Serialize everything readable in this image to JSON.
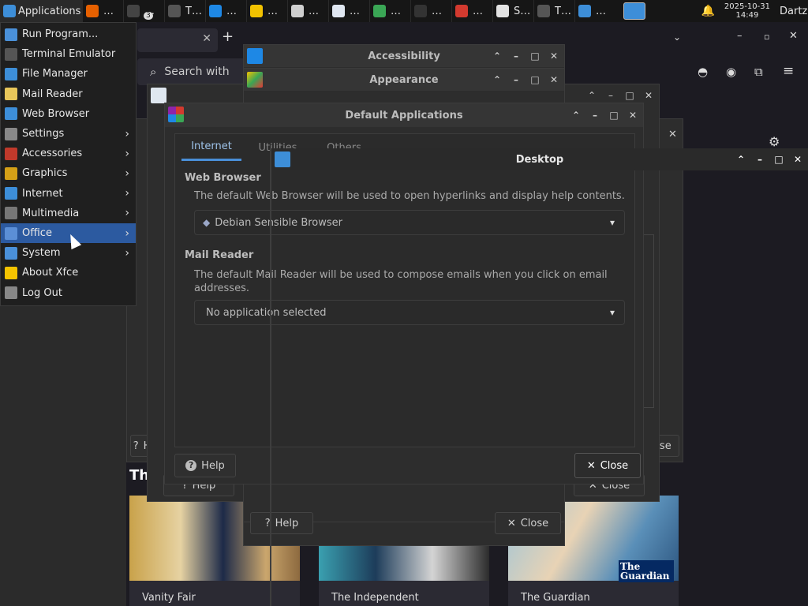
{
  "taskbar": {
    "applications_label": "Applications",
    "tasks": [
      {
        "label": "…",
        "icon": "firefox-icon",
        "color": "#e66000"
      },
      {
        "label": "…",
        "icon": "terminal-icon",
        "color": "#444444",
        "badge": "3"
      },
      {
        "label": "T…",
        "icon": "terminal-icon",
        "color": "#555555"
      },
      {
        "label": "…",
        "icon": "accessibility-icon",
        "color": "#1e88e5"
      },
      {
        "label": "…",
        "icon": "appearance-icon",
        "color": "#f2c200"
      },
      {
        "label": "…",
        "icon": "search-icon",
        "color": "#cfcfcf"
      },
      {
        "label": "…",
        "icon": "text-editor-icon",
        "color": "#dfe6f0"
      },
      {
        "label": "…",
        "icon": "color-icon",
        "color": "#3aa655"
      },
      {
        "label": "…",
        "icon": "menu-icon",
        "color": "#333333"
      },
      {
        "label": "…",
        "icon": "default-apps-icon",
        "color": "#d33a2f"
      },
      {
        "label": "S…",
        "icon": "settings-manager-icon",
        "color": "#e3e3e3"
      },
      {
        "label": "T…",
        "icon": "terminal-icon",
        "color": "#555555"
      },
      {
        "label": "…",
        "icon": "desktop-icon",
        "color": "#3d8ed8"
      }
    ],
    "date": "2025-10-31",
    "time": "14:49",
    "user": "Dartz"
  },
  "app_menu": {
    "items": [
      {
        "label": "Run Program...",
        "icon": "run-icon",
        "color": "#4a90d9",
        "submenu": false
      },
      {
        "label": "Terminal Emulator",
        "icon": "terminal-icon",
        "color": "#555555",
        "submenu": false
      },
      {
        "label": "File Manager",
        "icon": "folder-icon",
        "color": "#3d8ed8",
        "submenu": false
      },
      {
        "label": "Mail Reader",
        "icon": "mail-icon",
        "color": "#e8c65a",
        "submenu": false
      },
      {
        "label": "Web Browser",
        "icon": "globe-icon",
        "color": "#3d8ed8",
        "submenu": false
      },
      {
        "label": "Settings",
        "icon": "settings-icon",
        "color": "#888888",
        "submenu": true
      },
      {
        "label": "Accessories",
        "icon": "accessories-icon",
        "color": "#c0392b",
        "submenu": true
      },
      {
        "label": "Graphics",
        "icon": "graphics-icon",
        "color": "#d4a017",
        "submenu": true
      },
      {
        "label": "Internet",
        "icon": "internet-icon",
        "color": "#3d8ed8",
        "submenu": true
      },
      {
        "label": "Multimedia",
        "icon": "multimedia-icon",
        "color": "#777777",
        "submenu": true
      },
      {
        "label": "Office",
        "icon": "office-icon",
        "color": "#5b8fd6",
        "submenu": true,
        "active": true
      },
      {
        "label": "System",
        "icon": "system-icon",
        "color": "#4a90d9",
        "submenu": true
      },
      {
        "label": "About Xfce",
        "icon": "star-icon",
        "color": "#f5c400",
        "submenu": false
      },
      {
        "label": "Log Out",
        "icon": "logout-icon",
        "color": "#888888",
        "submenu": false
      }
    ]
  },
  "browser": {
    "search_placeholder": "Search with",
    "section_heading": "Th",
    "cards": [
      "Vanity Fair",
      "The Independent",
      "The Guardian"
    ],
    "guardian_logo": "The Guardian"
  },
  "accessibility_window": {
    "title": "Accessibility"
  },
  "appearance_window": {
    "title": "Appearance"
  },
  "default_apps": {
    "title": "Default Applications",
    "tabs": [
      "Internet",
      "Utilities",
      "Others"
    ],
    "web_browser": {
      "heading": "Web Browser",
      "description": "The default Web Browser will be used to open hyperlinks and display help contents.",
      "selected": "Debian Sensible Browser"
    },
    "mail_reader": {
      "heading": "Mail Reader",
      "description": "The default Mail Reader will be used to compose emails when you click on email addresses.",
      "selected": "No application selected"
    },
    "help_label": "Help",
    "close_label": "Close"
  },
  "desktop_window": {
    "title": "Desktop"
  },
  "background_buttons": {
    "help_label": "Help",
    "close_label": "Close"
  },
  "colors": {
    "accent": "#2c5aa0",
    "tab_underline": "#4a8fd8"
  }
}
